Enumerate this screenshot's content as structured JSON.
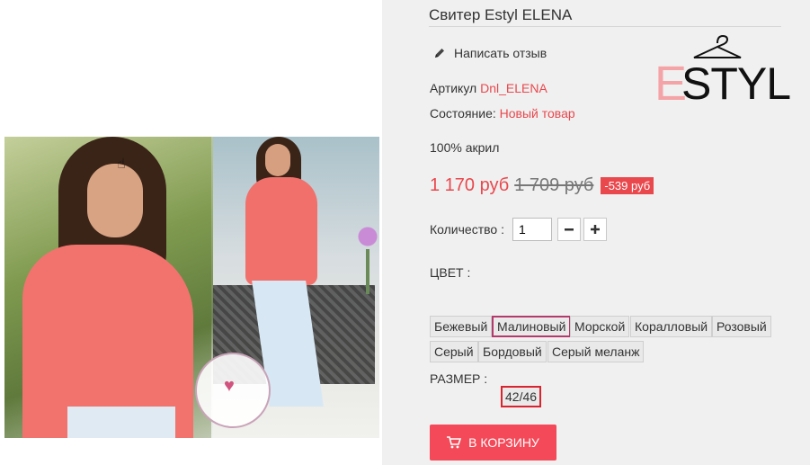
{
  "product": {
    "title": "Свитер Estyl ELENA",
    "review_label": "Написать отзыв",
    "sku_label": "Артикул",
    "sku_value": "Dnl_ELENA",
    "condition_label": "Состояние:",
    "condition_value": "Новый товар",
    "material": "100% акрил"
  },
  "brand_logo": {
    "letter_e": "E",
    "letters_styl": "STYL",
    "text": "ESTYL"
  },
  "price": {
    "current": "1 170 руб",
    "old": "1 709 руб",
    "discount": "-539 руб"
  },
  "quantity": {
    "label": "Количество :",
    "value": "1",
    "minus_icon": "minus-icon",
    "plus_icon": "plus-icon"
  },
  "color": {
    "label": "ЦВЕТ :",
    "selected": "Малиновый",
    "options": [
      "Бежевый",
      "Малиновый",
      "Морской",
      "Коралловый",
      "Розовый",
      "Серый",
      "Бордовый",
      "Серый меланж"
    ]
  },
  "size": {
    "label": "РАЗМЕР :",
    "selected": "42/46"
  },
  "cart": {
    "label": "В КОРЗИНУ",
    "icon": "cart-icon"
  },
  "colors": {
    "accent": "#e9484d",
    "cart_button": "#f44958",
    "selected_color_border": "#b33a6a",
    "selected_size_border": "#d9232f",
    "panel_bg": "#f0f0f0"
  }
}
